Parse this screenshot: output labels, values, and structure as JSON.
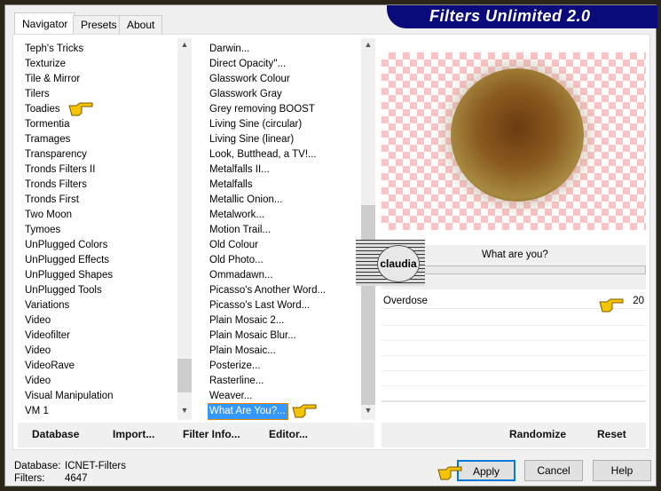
{
  "app": {
    "title": "Filters Unlimited 2.0"
  },
  "tabs": [
    {
      "label": "Navigator",
      "active": true
    },
    {
      "label": "Presets"
    },
    {
      "label": "About"
    }
  ],
  "categories": {
    "items": [
      "Teph's Tricks",
      "Texturize",
      "Tile & Mirror",
      "Tilers",
      "Toadies",
      "Tormentia",
      "Tramages",
      "Transparency",
      "Tronds Filters II",
      "Tronds Filters",
      "Tronds First",
      "Two Moon",
      "Tymoes",
      "UnPlugged Colors",
      "UnPlugged Effects",
      "UnPlugged Shapes",
      "UnPlugged Tools",
      "Variations",
      "Video",
      "Videofilter",
      "Video",
      "VideoRave",
      "Video",
      "Visual Manipulation",
      "VM 1"
    ],
    "selected": "Toadies"
  },
  "filters": {
    "items": [
      "Darwin...",
      "Direct Opacity''...",
      "Glasswork Colour",
      "Glasswork Gray",
      "Grey removing BOOST",
      "Living Sine (circular)",
      "Living Sine (linear)",
      "Look, Butthead, a TV!...",
      "Metalfalls II...",
      "Metalfalls",
      "Metallic Onion...",
      "Metalwork...",
      "Motion Trail...",
      "Old Colour",
      "Old Photo...",
      "Ommadawn...",
      "Picasso's Another Word...",
      "Picasso's Last Word...",
      "Plain Mosaic 2...",
      "Plain Mosaic Blur...",
      "Plain Mosaic...",
      "Posterize...",
      "Rasterline...",
      "Weaver...",
      "What Are You?..."
    ],
    "selected": "What Are You?..."
  },
  "toolbar": {
    "database": "Database",
    "import": "Import...",
    "filter_info": "Filter Info...",
    "editor": "Editor...",
    "randomize": "Randomize",
    "reset": "Reset"
  },
  "preview": {
    "filter_name": "What are you?",
    "watermark": "claudia"
  },
  "params": [
    {
      "label": "Overdose",
      "value": "20"
    }
  ],
  "status": {
    "database_label": "Database:",
    "database_value": "ICNET-Filters",
    "filters_label": "Filters:",
    "filters_value": "4647"
  },
  "buttons": {
    "apply": "Apply",
    "cancel": "Cancel",
    "help": "Help"
  },
  "colors": {
    "banner": "#0a0a7a",
    "selection": "#3399ff",
    "checker": "#fbc4c4",
    "frame": "#2b2619"
  }
}
